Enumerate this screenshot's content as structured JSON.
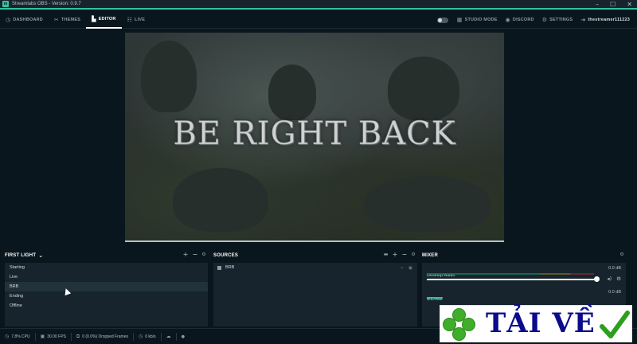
{
  "window": {
    "title": "Streamlabs OBS - Version: 0.9.7",
    "app_icon_glyph": "m",
    "controls": {
      "minimize": "–",
      "maximize": "☐",
      "close": "✕"
    }
  },
  "nav": {
    "left": [
      {
        "label": "DASHBOARD",
        "icon": "dashboard-icon",
        "glyph": "◷"
      },
      {
        "label": "THEMES",
        "icon": "themes-icon",
        "glyph": "✂"
      },
      {
        "label": "EDITOR",
        "icon": "editor-icon",
        "glyph": "▙",
        "active": true
      },
      {
        "label": "LIVE",
        "icon": "live-icon",
        "glyph": "☷"
      }
    ],
    "right": {
      "studio_mode": "STUDIO MODE",
      "studio_glyph": "▦",
      "discord": "DISCORD",
      "discord_glyph": "◉",
      "settings": "SETTINGS",
      "settings_glyph": "⚙",
      "user_glyph": "⇥",
      "username": "thestreamer111223"
    }
  },
  "preview": {
    "overlay_text": "BE RIGHT BACK"
  },
  "scenes": {
    "header": "FIRST LIGHT",
    "header_caret": "⌄",
    "controls": {
      "add": "+",
      "remove": "−",
      "settings": "⚙"
    },
    "items": [
      {
        "label": "Starting"
      },
      {
        "label": "Live"
      },
      {
        "label": "BRB",
        "selected": true
      },
      {
        "label": "Ending"
      },
      {
        "label": "Offline"
      }
    ]
  },
  "sources": {
    "header": "SOURCES",
    "controls": {
      "folder": "▬",
      "add": "+",
      "remove": "−",
      "settings": "⚙"
    },
    "items": [
      {
        "label": "BRB",
        "lock_glyph": "⌁",
        "visible_glyph": "◉"
      }
    ]
  },
  "mixer": {
    "header": "MIXER",
    "settings_glyph": "⚙",
    "items": [
      {
        "name": "Desktop Audio",
        "db": "0.0 dB",
        "volume": 1.0,
        "mute_glyph": "◂)",
        "settings_glyph": "⚙"
      },
      {
        "name": "Mic/Aux",
        "db": "0.0 dB"
      }
    ]
  },
  "status": {
    "cpu": "7.8% CPU",
    "cpu_glyph": "◷",
    "fps": "30.00 FPS",
    "fps_glyph": "▣",
    "dropped": "0 (0.0%) Dropped Frames",
    "dropped_glyph": "⧉",
    "bandwidth": "0 kb/s",
    "bandwidth_glyph": "◷",
    "extra_glyph_1": "☁",
    "extra_glyph_2": "●"
  },
  "watermark": {
    "text": "TẢI VỀ",
    "check_color": "#2e9e1f",
    "text_color": "#0b0b8c"
  },
  "colors": {
    "accent": "#31c3a2",
    "background": "#09161d",
    "panel": "#17242d"
  }
}
